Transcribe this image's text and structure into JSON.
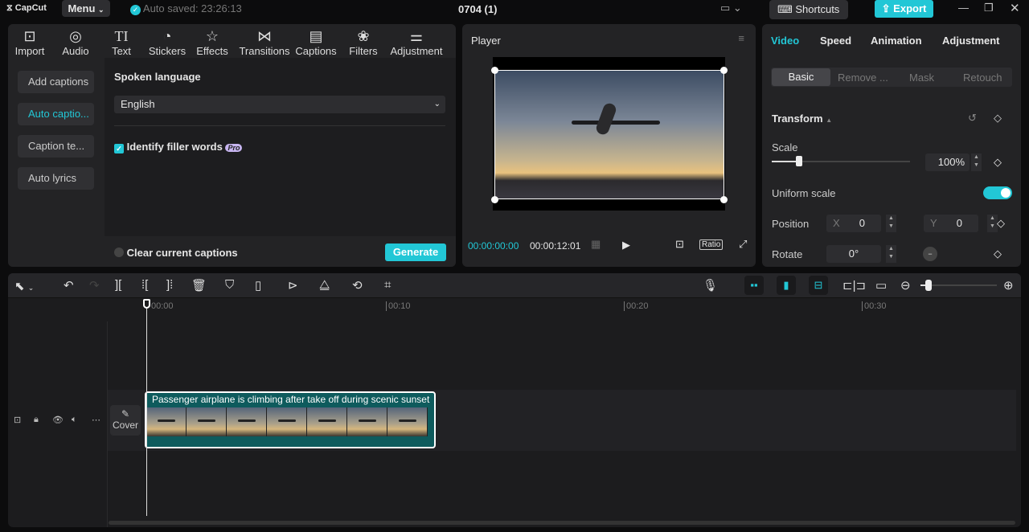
{
  "titlebar": {
    "logo": "CapCut",
    "menu": "Menu",
    "autosave": "Auto saved: 23:26:13",
    "project": "0704 (1)",
    "shortcuts": "Shortcuts",
    "export": "Export"
  },
  "media_tabs": [
    {
      "label": "Import",
      "icon": "import-icon"
    },
    {
      "label": "Audio",
      "icon": "audio-icon"
    },
    {
      "label": "Text",
      "icon": "text-icon"
    },
    {
      "label": "Stickers",
      "icon": "stickers-icon"
    },
    {
      "label": "Effects",
      "icon": "effects-icon"
    },
    {
      "label": "Transitions",
      "icon": "transitions-icon"
    },
    {
      "label": "Captions",
      "icon": "captions-icon",
      "active": true
    },
    {
      "label": "Filters",
      "icon": "filters-icon"
    },
    {
      "label": "Adjustment",
      "icon": "adjustment-icon"
    }
  ],
  "captions_menu": [
    "Add captions",
    "Auto captio...",
    "Caption te...",
    "Auto lyrics"
  ],
  "captions": {
    "spoken_language_label": "Spoken language",
    "language": "English",
    "filler_label": "Identify filler words",
    "pro": "Pro",
    "clear_label": "Clear current captions",
    "generate": "Generate"
  },
  "player": {
    "title": "Player",
    "current_time": "00:00:00:00",
    "total_time": "00:00:12:01",
    "ratio": "Ratio"
  },
  "inspector": {
    "tabs": [
      "Video",
      "Speed",
      "Animation",
      "Adjustment"
    ],
    "subtabs": [
      "Basic",
      "Remove ...",
      "Mask",
      "Retouch"
    ],
    "transform": "Transform",
    "scale_label": "Scale",
    "scale_value": "100%",
    "scale_fraction": 0.2,
    "uniform_label": "Uniform scale",
    "uniform_on": true,
    "position_label": "Position",
    "x_label": "X",
    "x_value": "0",
    "y_label": "Y",
    "y_value": "0",
    "rotate_label": "Rotate",
    "rotate_value": "0°"
  },
  "timeline": {
    "ruler": [
      "00:00",
      "00:10",
      "00:20",
      "00:30"
    ],
    "clip_title": "Passenger airplane is climbing after take off during scenic sunset",
    "cover": "Cover",
    "zoom_fraction": 0.1
  },
  "colors": {
    "accent": "#22c7d6"
  }
}
